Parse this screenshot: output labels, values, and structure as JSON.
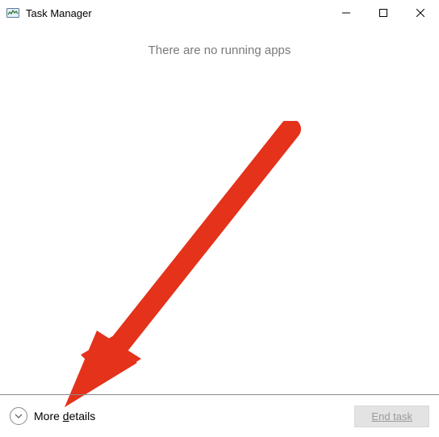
{
  "titlebar": {
    "title": "Task Manager"
  },
  "content": {
    "empty_message": "There are no running apps"
  },
  "footer": {
    "more_details_prefix": "More ",
    "more_details_key": "d",
    "more_details_suffix": "etails",
    "end_task_prefix": "E",
    "end_task_key": "n",
    "end_task_suffix": "d task"
  }
}
